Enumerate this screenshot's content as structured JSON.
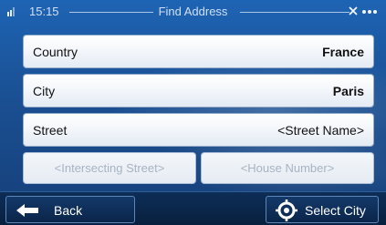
{
  "status": {
    "time": "15:15",
    "title": "Find Address"
  },
  "fields": {
    "country": {
      "label": "Country",
      "value": "France"
    },
    "city": {
      "label": "City",
      "value": "Paris"
    },
    "street": {
      "label": "Street",
      "value": "<Street Name>"
    }
  },
  "secondary": {
    "intersecting": "<Intersecting Street>",
    "house_number": "<House Number>"
  },
  "buttons": {
    "back": "Back",
    "select_city": "Select City"
  },
  "icons": {
    "signal": "signal-icon",
    "gps": "gps-status-icon",
    "back": "arrow-left-icon",
    "select_city": "crosshair-target-icon"
  }
}
